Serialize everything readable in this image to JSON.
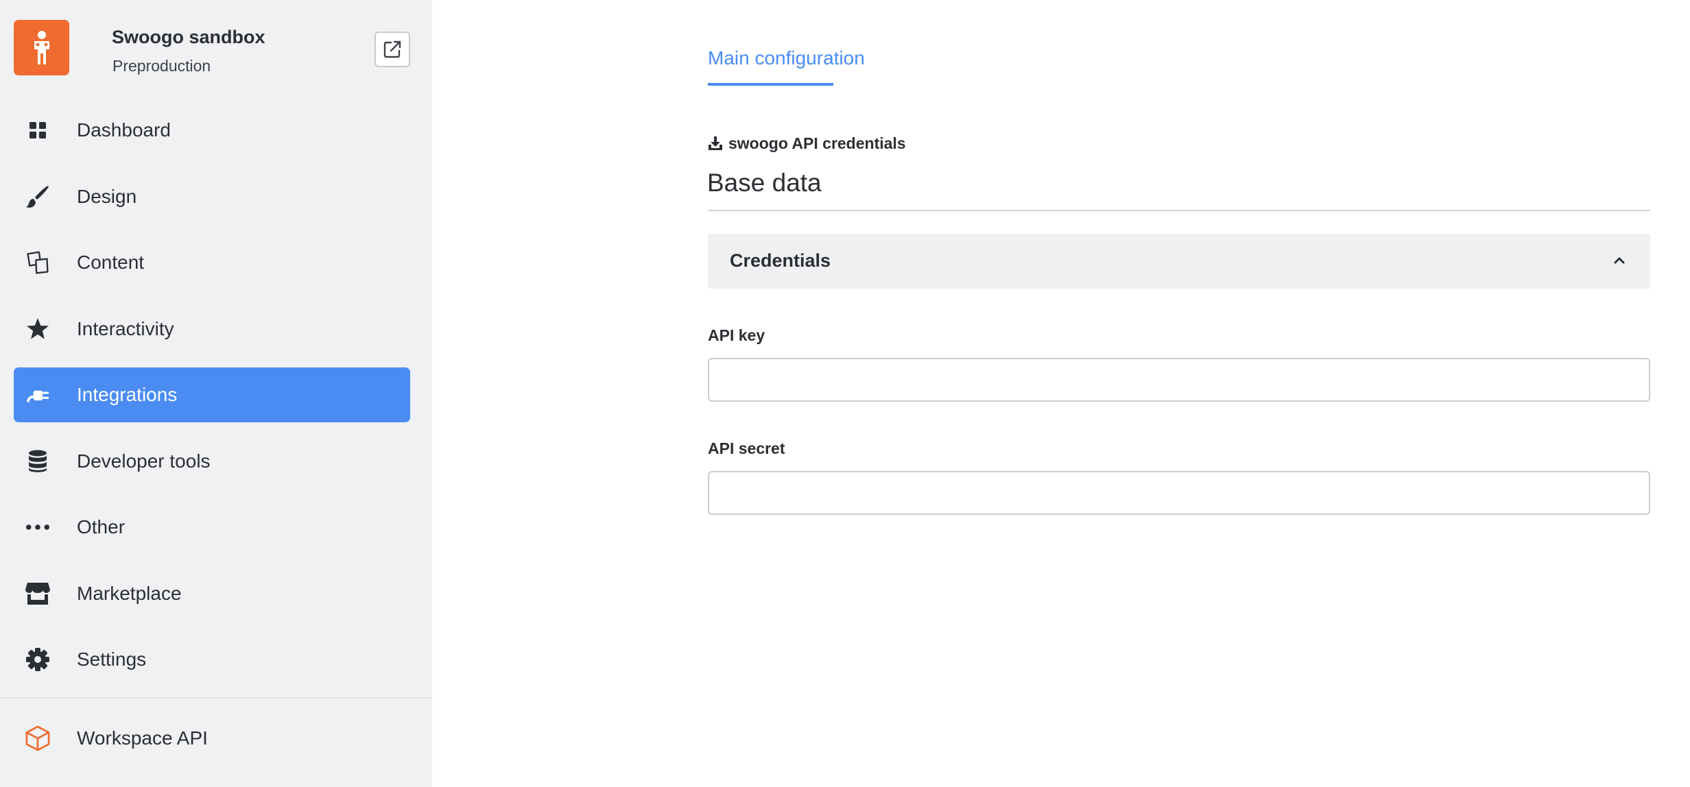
{
  "workspace": {
    "name": "Swoogo sandbox",
    "environment": "Preproduction",
    "logo_icon": "person-icon",
    "logo_color": "#ef6b2f",
    "open_external_icon": "external-link-icon"
  },
  "sidebar": {
    "items": [
      {
        "label": "Dashboard",
        "icon": "grid-icon",
        "active": false
      },
      {
        "label": "Design",
        "icon": "brush-icon",
        "active": false
      },
      {
        "label": "Content",
        "icon": "content-icon",
        "active": false
      },
      {
        "label": "Interactivity",
        "icon": "star-icon",
        "active": false
      },
      {
        "label": "Integrations",
        "icon": "plug-icon",
        "active": true
      },
      {
        "label": "Developer tools",
        "icon": "database-icon",
        "active": false
      },
      {
        "label": "Other",
        "icon": "ellipsis-icon",
        "active": false
      },
      {
        "label": "Marketplace",
        "icon": "store-icon",
        "active": false
      },
      {
        "label": "Settings",
        "icon": "gear-icon",
        "active": false
      }
    ],
    "footer_item": {
      "label": "Workspace API",
      "icon": "cube-icon"
    },
    "active_color": "#4a8cf2"
  },
  "main": {
    "tab": "Main configuration",
    "section_kicker": "swoogo API credentials",
    "section_title": "Base data",
    "panel": {
      "title": "Credentials",
      "expanded": true
    },
    "fields": [
      {
        "label": "API key",
        "value": "",
        "placeholder": ""
      },
      {
        "label": "API secret",
        "value": "",
        "placeholder": ""
      }
    ]
  }
}
